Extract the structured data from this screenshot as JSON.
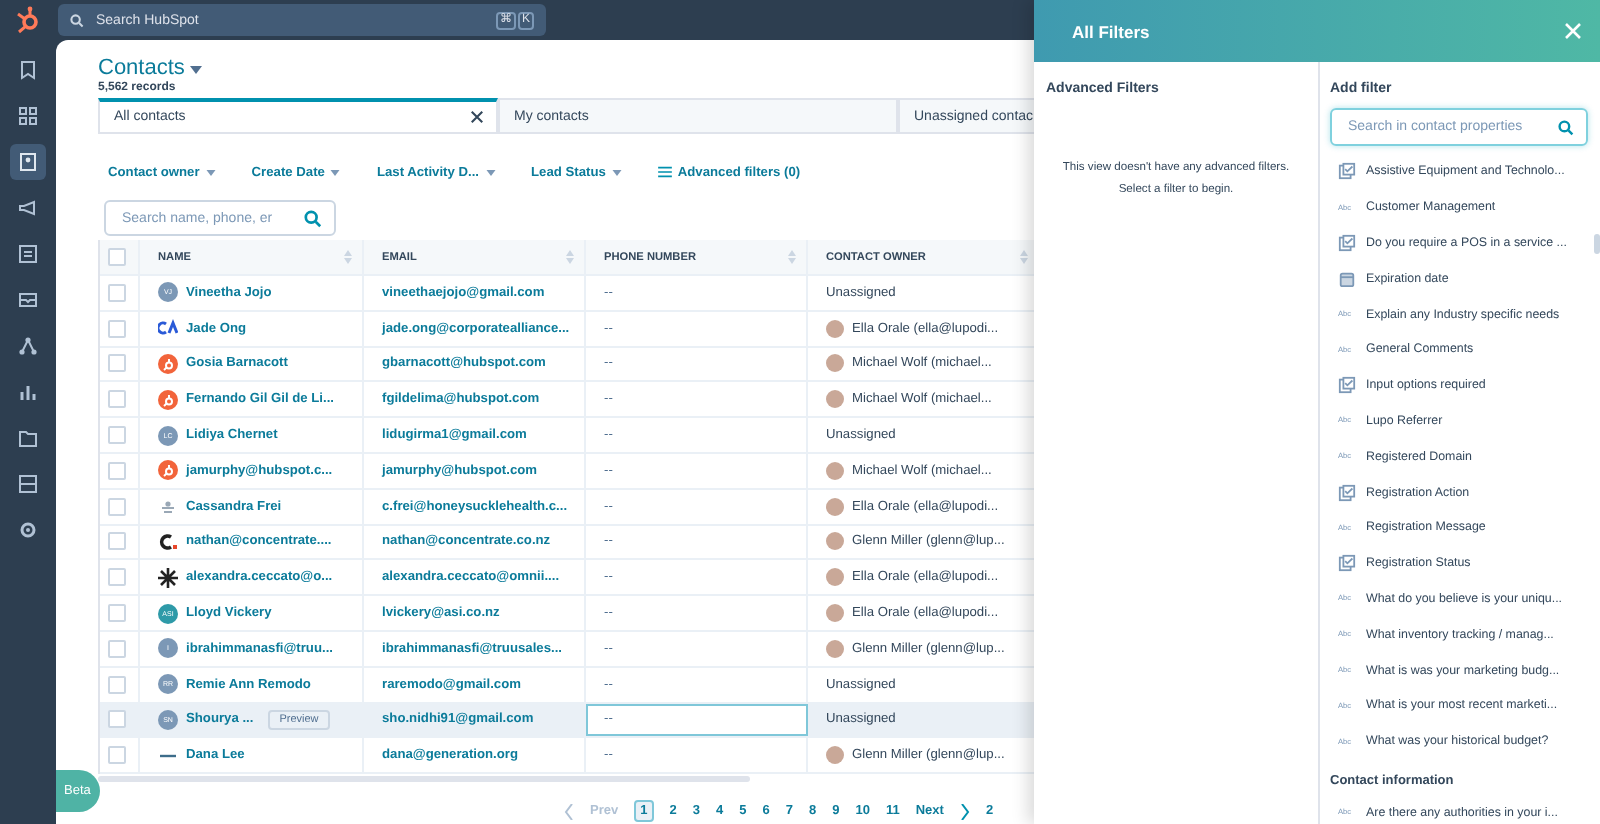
{
  "top_bar": {
    "search_placeholder": "Search HubSpot",
    "shortcut_keys": [
      "⌘",
      "K"
    ]
  },
  "sidebar": {
    "items": [
      {
        "kind": "bookmark",
        "selected": false
      },
      {
        "kind": "apps",
        "selected": false
      },
      {
        "kind": "contacts",
        "selected": true
      },
      {
        "kind": "megaphone",
        "selected": false
      },
      {
        "kind": "content",
        "selected": false
      },
      {
        "kind": "inbox",
        "selected": false
      },
      {
        "kind": "automation",
        "selected": false
      },
      {
        "kind": "reports",
        "selected": false
      },
      {
        "kind": "folder",
        "selected": false
      },
      {
        "kind": "library",
        "selected": false
      },
      {
        "kind": "settings",
        "selected": false
      }
    ]
  },
  "beta_button": "Beta",
  "page": {
    "title": "Contacts",
    "record_count": "5,562 records"
  },
  "view_tabs": [
    {
      "label": "All contacts",
      "selected": true,
      "closable": true
    },
    {
      "label": "My contacts",
      "selected": false,
      "closable": false
    },
    {
      "label": "Unassigned contac",
      "selected": false,
      "closable": false
    }
  ],
  "filters": [
    {
      "label": "Contact owner",
      "kind": "dropdown"
    },
    {
      "label": "Create Date",
      "kind": "dropdown"
    },
    {
      "label": "Last Activity D...",
      "kind": "dropdown"
    },
    {
      "label": "Lead Status",
      "kind": "dropdown"
    },
    {
      "label": "Advanced filters (0)",
      "kind": "advanced"
    }
  ],
  "table_search": {
    "placeholder": "Search name, phone, er"
  },
  "table": {
    "select_all_checked": false,
    "columns": [
      "NAME",
      "EMAIL",
      "PHONE NUMBER",
      "CONTACT OWNER"
    ],
    "rows": [
      {
        "checked": false,
        "avatar": {
          "kind": "initials",
          "text": "VJ"
        },
        "name": "Vineetha Jojo",
        "email": "vineethaejojo@gmail.com",
        "phone": "--",
        "owner": "Unassigned",
        "owner_avatar": false,
        "hovered": false,
        "phone_focused": false
      },
      {
        "checked": false,
        "avatar": {
          "kind": "logo-ca"
        },
        "name": "Jade Ong",
        "email": "jade.ong@corporatealliance...",
        "phone": "--",
        "owner": "Ella Orale (ella@lupodi...",
        "owner_avatar": true,
        "hovered": false,
        "phone_focused": false
      },
      {
        "checked": false,
        "avatar": {
          "kind": "sprocket"
        },
        "name": "Gosia Barnacott",
        "email": "gbarnacott@hubspot.com",
        "phone": "--",
        "owner": "Michael Wolf (michael...",
        "owner_avatar": true,
        "hovered": false,
        "phone_focused": false
      },
      {
        "checked": false,
        "avatar": {
          "kind": "sprocket"
        },
        "name": "Fernando Gil Gil de Li...",
        "email": "fgildelima@hubspot.com",
        "phone": "--",
        "owner": "Michael Wolf (michael...",
        "owner_avatar": true,
        "hovered": false,
        "phone_focused": false
      },
      {
        "checked": false,
        "avatar": {
          "kind": "initials",
          "text": "LC"
        },
        "name": "Lidiya Chernet",
        "email": "lidugirma1@gmail.com",
        "phone": "--",
        "owner": "Unassigned",
        "owner_avatar": false,
        "hovered": false,
        "phone_focused": false
      },
      {
        "checked": false,
        "avatar": {
          "kind": "sprocket"
        },
        "name": "jamurphy@hubspot.c...",
        "email": "jamurphy@hubspot.com",
        "phone": "--",
        "owner": "Michael Wolf (michael...",
        "owner_avatar": true,
        "hovered": false,
        "phone_focused": false
      },
      {
        "checked": false,
        "avatar": {
          "kind": "logo-leaf"
        },
        "name": "Cassandra Frei",
        "email": "c.frei@honeysucklehealth.c...",
        "phone": "--",
        "owner": "Ella Orale (ella@lupodi...",
        "owner_avatar": true,
        "hovered": false,
        "phone_focused": false
      },
      {
        "checked": false,
        "avatar": {
          "kind": "logo-c"
        },
        "name": "nathan@concentrate....",
        "email": "nathan@concentrate.co.nz",
        "phone": "--",
        "owner": "Glenn Miller (glenn@lup...",
        "owner_avatar": true,
        "hovered": false,
        "phone_focused": false
      },
      {
        "checked": false,
        "avatar": {
          "kind": "logo-star"
        },
        "name": "alexandra.ceccato@o...",
        "email": "alexandra.ceccato@omnii....",
        "phone": "--",
        "owner": "Ella Orale (ella@lupodi...",
        "owner_avatar": true,
        "hovered": false,
        "phone_focused": false
      },
      {
        "checked": false,
        "avatar": {
          "kind": "badge",
          "text": "ASI"
        },
        "name": "Lloyd Vickery",
        "email": "lvickery@asi.co.nz",
        "phone": "--",
        "owner": "Ella Orale (ella@lupodi...",
        "owner_avatar": true,
        "hovered": false,
        "phone_focused": false
      },
      {
        "checked": false,
        "avatar": {
          "kind": "initials",
          "text": "I"
        },
        "name": "ibrahimmanasfi@truu...",
        "email": "ibrahimmanasfi@truusales...",
        "phone": "--",
        "owner": "Glenn Miller (glenn@lup...",
        "owner_avatar": true,
        "hovered": false,
        "phone_focused": false
      },
      {
        "checked": false,
        "avatar": {
          "kind": "initials",
          "text": "RR"
        },
        "name": "Remie Ann Remodo",
        "email": "raremodo@gmail.com",
        "phone": "--",
        "owner": "Unassigned",
        "owner_avatar": false,
        "hovered": false,
        "phone_focused": false
      },
      {
        "checked": false,
        "avatar": {
          "kind": "initials",
          "text": "SN"
        },
        "name": "Shourya ...",
        "email": "sho.nidhi91@gmail.com",
        "phone": "--",
        "owner": "Unassigned",
        "owner_avatar": false,
        "hovered": true,
        "phone_focused": true,
        "preview": "Preview"
      },
      {
        "checked": false,
        "avatar": {
          "kind": "dash"
        },
        "name": "Dana Lee",
        "email": "dana@generation.org",
        "phone": "--",
        "owner": "Glenn Miller (glenn@lup...",
        "owner_avatar": true,
        "hovered": false,
        "phone_focused": false
      }
    ]
  },
  "pagination": {
    "prev": "Prev",
    "next": "Next",
    "pages": [
      {
        "label": "1",
        "selected": true
      },
      {
        "label": "2",
        "selected": false
      },
      {
        "label": "3",
        "selected": false
      },
      {
        "label": "4",
        "selected": false
      },
      {
        "label": "5",
        "selected": false
      },
      {
        "label": "6",
        "selected": false
      },
      {
        "label": "7",
        "selected": false
      },
      {
        "label": "8",
        "selected": false
      },
      {
        "label": "9",
        "selected": false
      },
      {
        "label": "10",
        "selected": false
      },
      {
        "label": "11",
        "selected": false
      }
    ],
    "after": "2"
  },
  "filters_panel": {
    "title": "All Filters",
    "advanced_title": "Advanced Filters",
    "empty_message": "This view doesn't have any advanced filters. Select a filter to begin.",
    "add_title": "Add filter",
    "search_placeholder": "Search in contact properties",
    "properties": [
      {
        "kind": "checkbox",
        "label": "Assistive Equipment and Technolo..."
      },
      {
        "kind": "text",
        "type_label": "Abc",
        "label": "Customer Management"
      },
      {
        "kind": "checkbox",
        "label": "Do you require a POS in a service ..."
      },
      {
        "kind": "date",
        "label": "Expiration date"
      },
      {
        "kind": "text",
        "type_label": "Abc",
        "label": "Explain any Industry specific needs"
      },
      {
        "kind": "text",
        "type_label": "Abc",
        "label": "General Comments"
      },
      {
        "kind": "checkbox",
        "label": "Input options required"
      },
      {
        "kind": "text",
        "type_label": "Abc",
        "label": "Lupo Referrer"
      },
      {
        "kind": "text",
        "type_label": "Abc",
        "label": "Registered Domain"
      },
      {
        "kind": "checkbox",
        "label": "Registration Action"
      },
      {
        "kind": "text",
        "type_label": "Abc",
        "label": "Registration Message"
      },
      {
        "kind": "checkbox",
        "label": "Registration Status"
      },
      {
        "kind": "text",
        "type_label": "Abc",
        "label": "What do you believe is your uniqu..."
      },
      {
        "kind": "text",
        "type_label": "Abc",
        "label": "What inventory tracking / manag..."
      },
      {
        "kind": "text",
        "type_label": "Abc",
        "label": "What is was your marketing budg..."
      },
      {
        "kind": "text",
        "type_label": "Abc",
        "label": "What is your most recent marketi..."
      },
      {
        "kind": "text",
        "type_label": "Abc",
        "label": "What was your historical budget?"
      }
    ],
    "group_title": "Contact information",
    "group_properties": [
      {
        "kind": "text",
        "type_label": "Abc",
        "label": "Are there any authorities in your i..."
      }
    ]
  }
}
